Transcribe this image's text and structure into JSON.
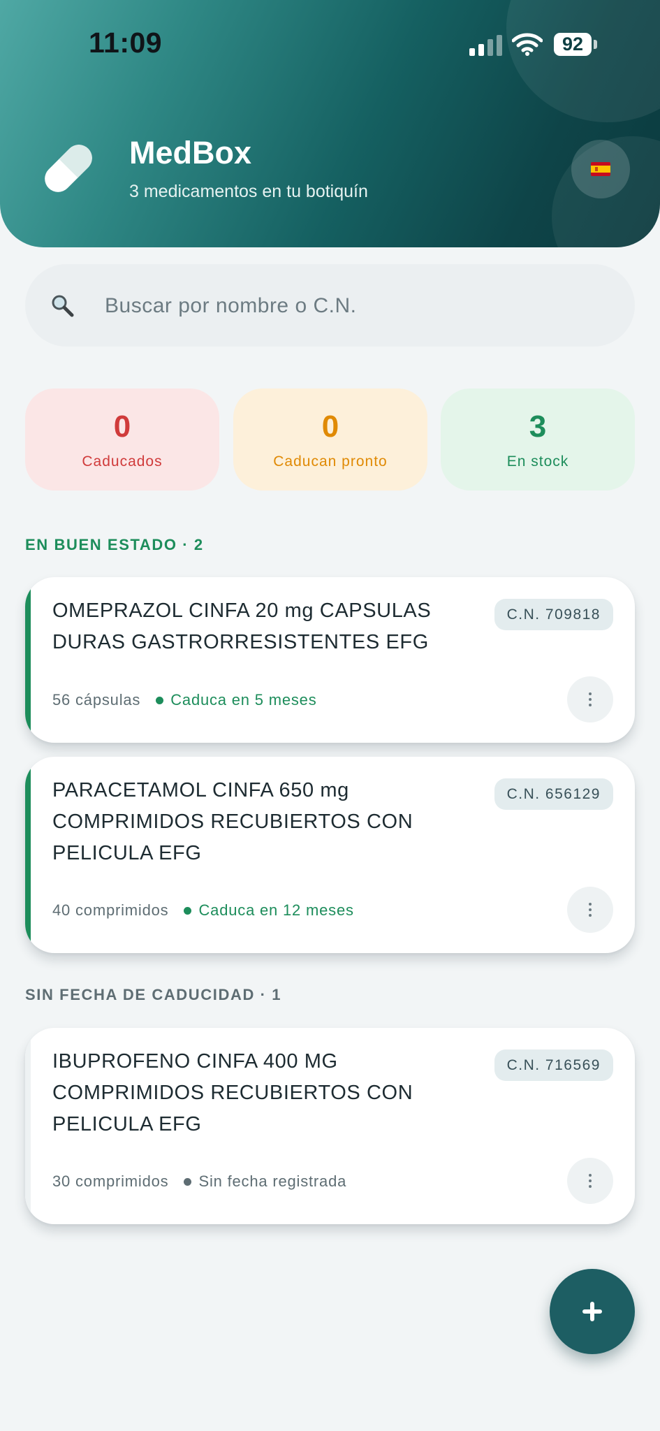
{
  "status_bar": {
    "time": "11:09",
    "battery": "92"
  },
  "header": {
    "app_name": "MedBox",
    "subtitle": "3 medicamentos en tu botiquín",
    "language_flag": "🇪🇸"
  },
  "search": {
    "placeholder": "Buscar por nombre o C.N.",
    "value": ""
  },
  "stats": [
    {
      "value": "0",
      "label": "Caducados",
      "color": "#d03b3b"
    },
    {
      "value": "0",
      "label": "Caducan pronto",
      "color": "#e08a05"
    },
    {
      "value": "3",
      "label": "En stock",
      "color": "#1d8d5b"
    }
  ],
  "sections": [
    {
      "heading": "EN BUEN ESTADO · 2",
      "color": "#1d8d5b",
      "items": [
        {
          "name": "OMEPRAZOL CINFA 20 mg CAPSULAS DURAS GASTRORRESISTENTES EFG",
          "cn": "C.N. 709818",
          "quantity": "56 cápsulas",
          "expiry": "Caduca en 5 meses"
        },
        {
          "name": "PARACETAMOL CINFA 650 mg COMPRIMIDOS RECUBIERTOS CON PELICULA EFG",
          "cn": "C.N. 656129",
          "quantity": "40 comprimidos",
          "expiry": "Caduca en 12 meses"
        }
      ]
    },
    {
      "heading": "SIN FECHA DE CADUCIDAD · 1",
      "color": "#5e6d73",
      "items": [
        {
          "name": "IBUPROFENO CINFA 400 MG COMPRIMIDOS RECUBIERTOS CON PELICULA EFG",
          "cn": "C.N. 716569",
          "quantity": "30 comprimidos",
          "expiry": "Sin fecha registrada"
        }
      ]
    }
  ],
  "colors": {
    "header_dark": "#0b3a3e",
    "header_light": "#4fa8a4",
    "good": "#1d8d5b",
    "neutral": "#5e6d73",
    "fab": "#1d5e63"
  },
  "icons": {
    "logo": "pill-icon",
    "search": "magnifier-icon",
    "more": "vertical-ellipsis-icon",
    "add": "plus-icon"
  }
}
